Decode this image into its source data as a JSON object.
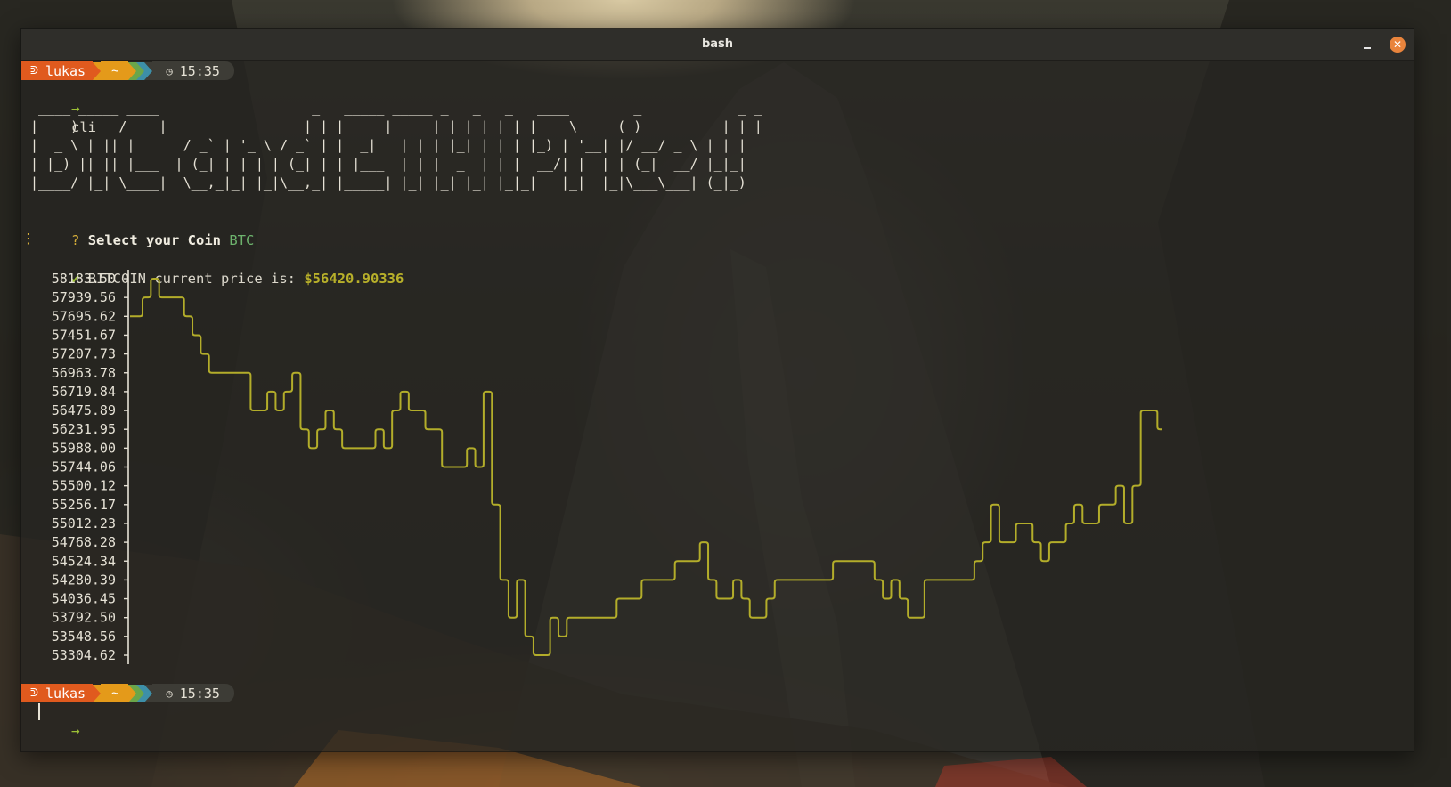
{
  "window": {
    "title": "bash",
    "minimize_label": "",
    "close_label": "✕"
  },
  "prompt1": {
    "user": "lukas",
    "dir": "~",
    "time": "15:35",
    "command": "cli"
  },
  "banner": [
    " ____ _____ ____                   _   _____ _____ _   _   _   ____        _            _ _ ",
    "| __ )_   _/ ___|   __ _ _ __   __| | | ____|_   _| | | | | | |  _ \\ _ __(_) ___ ___  | | |",
    "|  _ \\ | || |      / _` | '_ \\ / _` | |  _|   | | | |_| | | | |_) | '__| |/ __/ _ \\ | | |",
    "| |_) || || |___  | (_| | | | | (_| | | |___  | | |  _  | | |  __/| |  | | (_|  __/ |_|_|",
    "|____/ |_| \\____|  \\__,_|_| |_|\\__,_| |_____| |_| |_| |_| |_|_|   |_|  |_|\\___\\___| (_|_)"
  ],
  "select": {
    "q": "?",
    "label": "Select your Coin",
    "value": "BTC",
    "dots": "⋮"
  },
  "result": {
    "check": "✔",
    "label": "BITCOIN current price is:",
    "price": "$56420.90336"
  },
  "chart_data": {
    "type": "line",
    "y_ticks": [
      "58183.50",
      "57939.56",
      "57695.62",
      "57451.67",
      "57207.73",
      "56963.78",
      "56719.84",
      "56475.89",
      "56231.95",
      "55988.00",
      "55744.06",
      "55500.12",
      "55256.17",
      "55012.23",
      "54768.28",
      "54524.34",
      "54280.39",
      "54036.45",
      "53792.50",
      "53548.56",
      "53304.62"
    ],
    "ylim": [
      53304.62,
      58183.5
    ],
    "grid": false,
    "values": [
      57695.62,
      57695.62,
      57939.56,
      58183.5,
      57939.56,
      57939.56,
      57939.56,
      57695.62,
      57451.67,
      57207.73,
      56963.78,
      56963.78,
      56963.78,
      56963.78,
      56963.78,
      56475.89,
      56475.89,
      56719.84,
      56475.89,
      56719.84,
      56963.78,
      56231.95,
      55988.0,
      56231.95,
      56475.89,
      56231.95,
      55988.0,
      55988.0,
      55988.0,
      55988.0,
      56231.95,
      55988.0,
      56475.89,
      56719.84,
      56475.89,
      56475.89,
      56231.95,
      56231.95,
      55744.06,
      55744.06,
      55744.06,
      55988.0,
      55744.06,
      56719.84,
      55256.17,
      54280.39,
      53792.5,
      54280.39,
      53548.56,
      53304.62,
      53304.62,
      53792.5,
      53548.56,
      53792.5,
      53792.5,
      53792.5,
      53792.5,
      53792.5,
      53792.5,
      54036.45,
      54036.45,
      54036.45,
      54280.39,
      54280.39,
      54280.39,
      54280.39,
      54524.34,
      54524.34,
      54524.34,
      54768.28,
      54280.39,
      54036.45,
      54036.45,
      54280.39,
      54036.45,
      53792.5,
      53792.5,
      54036.45,
      54280.39,
      54280.39,
      54280.39,
      54280.39,
      54280.39,
      54280.39,
      54280.39,
      54524.34,
      54524.34,
      54524.34,
      54524.34,
      54524.34,
      54280.39,
      54036.45,
      54280.39,
      54036.45,
      53792.5,
      53792.5,
      54280.39,
      54280.39,
      54280.39,
      54280.39,
      54280.39,
      54280.39,
      54524.34,
      54768.28,
      55256.17,
      54768.28,
      54768.28,
      55012.23,
      55012.23,
      54768.28,
      54524.34,
      54768.28,
      54768.28,
      55012.23,
      55256.17,
      55012.23,
      55012.23,
      55256.17,
      55256.17,
      55500.12,
      55012.23,
      55500.12,
      56475.89,
      56475.89,
      56231.95
    ]
  },
  "prompt2": {
    "user": "lukas",
    "dir": "~",
    "time": "15:35"
  },
  "glyphs": {
    "prompt_arrow": "→",
    "flame": "ᕲ",
    "clock": "◷"
  }
}
